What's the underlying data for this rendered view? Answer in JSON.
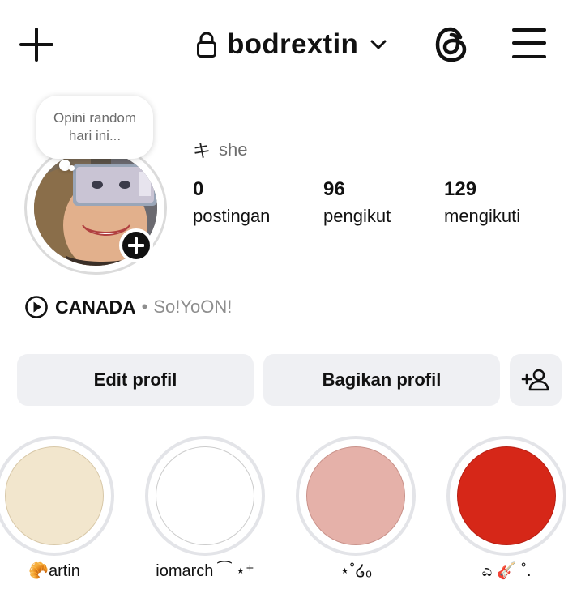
{
  "header": {
    "username": "bodrextin",
    "create_icon": "plus-icon",
    "lock_icon": "lock-icon",
    "switch_icon": "chevron-down-icon",
    "threads_icon": "threads-icon",
    "menu_icon": "hamburger-menu-icon"
  },
  "profile": {
    "note": "Opini random hari ini...",
    "pronouns": "she",
    "pronoun_icon": "キ",
    "stats": [
      {
        "value": "0",
        "label": "postingan"
      },
      {
        "value": "96",
        "label": "pengikut"
      },
      {
        "value": "129",
        "label": "mengikuti"
      }
    ]
  },
  "music": {
    "title": "CANADA",
    "separator": "•",
    "artist": "So!YoON!",
    "icon": "play-circle-icon"
  },
  "actions": {
    "edit_profile": "Edit profil",
    "share_profile": "Bagikan profil",
    "discover_people_icon": "add-person-icon"
  },
  "highlights": [
    {
      "label": "🥐artin",
      "color": "#f2e6cd"
    },
    {
      "label": "iomarch ⁀ ⋆⁺",
      "color": "#ffffff"
    },
    {
      "label": "⋆˚໒ₒ",
      "color": "#e5b1a9"
    },
    {
      "label": "ಎ 🎸 ˚.",
      "color": "#d62718"
    }
  ]
}
